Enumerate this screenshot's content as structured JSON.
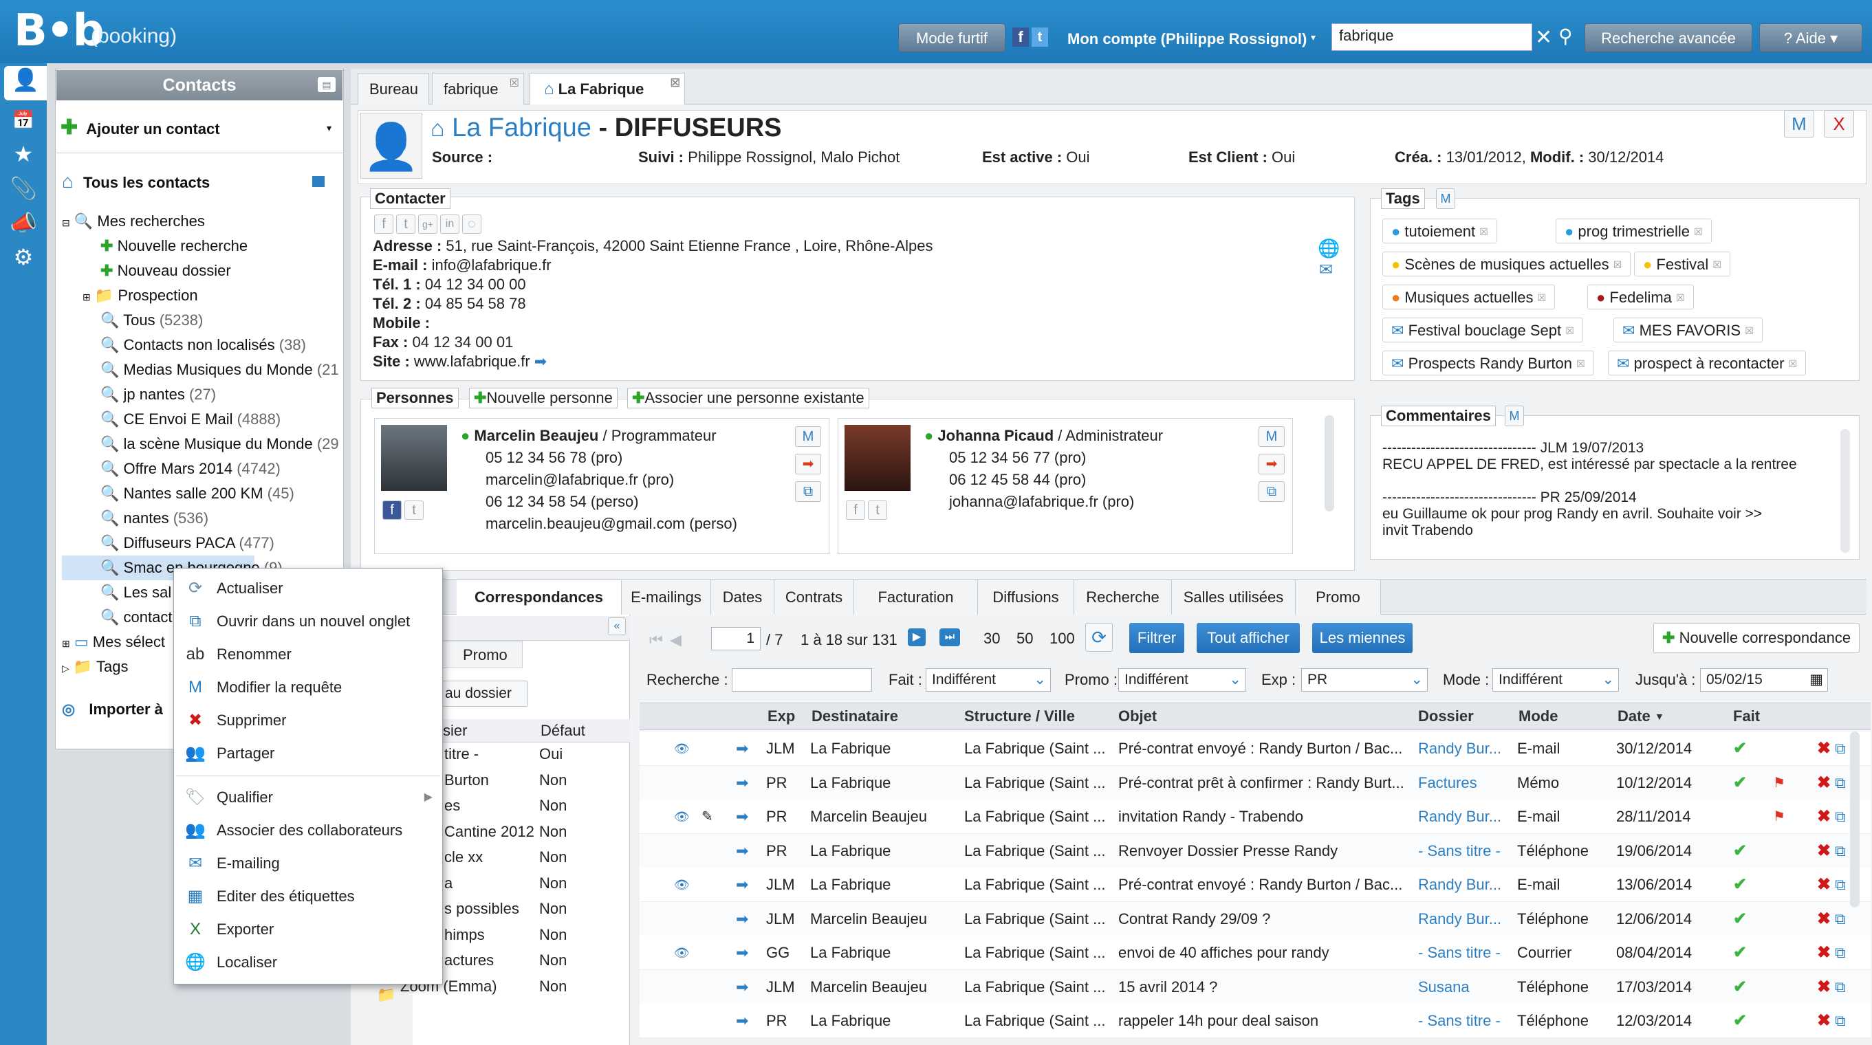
{
  "app": {
    "logo": "B•b",
    "logo_sub": "(booking)"
  },
  "header": {
    "mode_furtif": "Mode furtif",
    "account": "Mon compte (Philippe Rossignol)",
    "search_value": "fabrique",
    "advanced_search": "Recherche avancée",
    "help": "Aide"
  },
  "contacts_panel": {
    "title": "Contacts",
    "add_contact": "Ajouter un contact",
    "all_contacts": "Tous les contacts",
    "my_searches": "Mes recherches",
    "new_search": "Nouvelle recherche",
    "new_folder": "Nouveau dossier",
    "prospection": "Prospection",
    "searches": [
      {
        "label": "Tous",
        "count": "(5238)"
      },
      {
        "label": "Contacts non localisés",
        "count": "(38)"
      },
      {
        "label": "Medias Musiques du Monde",
        "count": "(21"
      },
      {
        "label": "jp nantes",
        "count": "(27)"
      },
      {
        "label": "CE Envoi E Mail",
        "count": "(4888)"
      },
      {
        "label": "la scène Musique du Monde",
        "count": "(29"
      },
      {
        "label": "Offre Mars 2014",
        "count": "(4742)"
      },
      {
        "label": "Nantes salle 200 KM",
        "count": "(45)"
      },
      {
        "label": "nantes",
        "count": "(536)"
      },
      {
        "label": "Diffuseurs PACA",
        "count": "(477)"
      },
      {
        "label": "Smac en bourgogne",
        "count": "(9)"
      },
      {
        "label": "Les sal",
        "count": ""
      },
      {
        "label": "contact",
        "count": ""
      }
    ],
    "my_selections": "Mes sélect",
    "tags": "Tags",
    "import": "Importer à"
  },
  "tabs": [
    {
      "label": "Bureau"
    },
    {
      "label": "fabrique"
    },
    {
      "label": "La Fabrique"
    }
  ],
  "record": {
    "name": "La Fabrique",
    "sep": "-",
    "category": "DIFFUSEURS",
    "source_label": "Source :",
    "suivi_label": "Suivi :",
    "suivi_value": "Philippe Rossignol, Malo Pichot",
    "active_label": "Est active :",
    "active_value": "Oui",
    "client_label": "Est Client :",
    "client_value": "Oui",
    "crea_label": "Créa. :",
    "crea_value": "13/01/2012,",
    "modif_label": "Modif. :",
    "modif_value": "30/12/2014",
    "m_btn": "M",
    "x_btn": "X"
  },
  "contacter": {
    "legend": "Contacter",
    "address_label": "Adresse :",
    "address": "51, rue Saint-François, 42000 Saint Etienne France , Loire, Rhône-Alpes",
    "email_label": "E-mail :",
    "email": "info@lafabrique.fr",
    "tel1_label": "Tél. 1 :",
    "tel1": "04 12 34 00 00",
    "tel2_label": "Tél. 2 :",
    "tel2": "04 85 54 58 78",
    "mobile_label": "Mobile :",
    "fax_label": "Fax :",
    "fax": "04 12 34 00 01",
    "site_label": "Site :",
    "site": "www.lafabrique.fr"
  },
  "tags_box": {
    "legend": "Tags",
    "items": [
      {
        "label": "tutoiement",
        "color": "#2a9be0",
        "kind": "dot"
      },
      {
        "label": "prog trimestrielle",
        "color": "#2a9be0",
        "kind": "dot"
      },
      {
        "label": "Scènes de musiques actuelles",
        "color": "#f2c200",
        "kind": "dot"
      },
      {
        "label": "Festival",
        "color": "#f2c200",
        "kind": "dot"
      },
      {
        "label": "Musiques actuelles",
        "color": "#f07a1a",
        "kind": "dot"
      },
      {
        "label": "Fedelima",
        "color": "#a01818",
        "kind": "dot"
      },
      {
        "label": "Festival bouclage Sept",
        "color": "#2a7fc2",
        "kind": "mail"
      },
      {
        "label": "MES FAVORIS",
        "color": "#2a7fc2",
        "kind": "mail"
      },
      {
        "label": "Prospects Randy Burton",
        "color": "#2a7fc2",
        "kind": "mail"
      },
      {
        "label": "prospect à recontacter",
        "color": "#2a7fc2",
        "kind": "mail"
      }
    ]
  },
  "comments": {
    "legend": "Commentaires",
    "lines": [
      "-------------------------------- JLM 19/07/2013",
      "RECU APPEL DE FRED, est intéressé par spectacle a la rentree",
      "",
      "-------------------------------- PR 25/09/2014",
      "eu Guillaume ok pour prog Randy en avril. Souhaite voir >>",
      "invit Trabendo"
    ]
  },
  "persons": {
    "legend": "Personnes",
    "new_person": "Nouvelle personne",
    "associate": "Associer une personne existante",
    "cards": [
      {
        "name": "Marcelin Beaujeu",
        "role": "/ Programmateur",
        "lines": [
          "05 12 34 56 78 (pro)",
          "marcelin@lafabrique.fr (pro)",
          "06 12 34 58 54 (perso)",
          "marcelin.beaujeu@gmail.com (perso)"
        ]
      },
      {
        "name": "Johanna Picaud",
        "role": "/ Administrateur",
        "lines": [
          "05 12 34 56 77 (pro)",
          "06 12 45 58 44 (pro)",
          "johanna@lafabrique.fr (pro)"
        ]
      }
    ]
  },
  "subtabs": [
    "Correspondances",
    "E-mailings",
    "Dates",
    "Contrats",
    "Facturation",
    "Diffusions",
    "Recherche",
    "Salles utilisées",
    "Promo"
  ],
  "mid_panel": {
    "tab": "Promo",
    "btn": "au dossier",
    "col1": "sier",
    "col2": "Défaut",
    "rows": [
      {
        "a": "titre -",
        "b": "Oui"
      },
      {
        "a": "Burton",
        "b": "Non"
      },
      {
        "a": "es",
        "b": "Non"
      },
      {
        "a": "Cantine 2012",
        "b": "Non"
      },
      {
        "a": "cle xx",
        "b": "Non"
      },
      {
        "a": "a",
        "b": "Non"
      },
      {
        "a": "s possibles",
        "b": "Non"
      },
      {
        "a": "himps",
        "b": "Non"
      },
      {
        "a": "actures",
        "b": "Non"
      },
      {
        "a": "Zoom (Emma)",
        "b": "Non"
      }
    ]
  },
  "context_menu": [
    {
      "label": "Actualiser",
      "icon": "refresh-icon",
      "glyph": "⟳"
    },
    {
      "label": "Ouvrir dans un nouvel onglet",
      "icon": "new-tab-icon",
      "glyph": "⧉"
    },
    {
      "label": "Renommer",
      "icon": "rename-icon",
      "glyph": "ab"
    },
    {
      "label": "Modifier la requête",
      "icon": "edit-query-icon",
      "glyph": "M"
    },
    {
      "label": "Supprimer",
      "icon": "delete-icon",
      "glyph": "✖"
    },
    {
      "label": "Partager",
      "icon": "share-icon",
      "glyph": "👥"
    },
    {
      "label": "Qualifier",
      "icon": "tag-icon",
      "glyph": "🏷"
    },
    {
      "label": "Associer des collaborateurs",
      "icon": "collaborators-icon",
      "glyph": "👥"
    },
    {
      "label": "E-mailing",
      "icon": "mail-icon",
      "glyph": "✉"
    },
    {
      "label": "Editer des étiquettes",
      "icon": "labels-icon",
      "glyph": "▦"
    },
    {
      "label": "Exporter",
      "icon": "excel-icon",
      "glyph": "X"
    },
    {
      "label": "Localiser",
      "icon": "globe-icon",
      "glyph": "🌐"
    }
  ],
  "correspondences": {
    "page_value": "1",
    "page_total": "/ 7",
    "range": "1 à 18 sur 131",
    "sizes": [
      "30",
      "50",
      "100"
    ],
    "filter": "Filtrer",
    "show_all": "Tout afficher",
    "mine": "Les miennes",
    "new_corr": "Nouvelle correspondance",
    "search_label": "Recherche :",
    "fait_label": "Fait :",
    "fait_value": "Indifférent",
    "promo_label": "Promo :",
    "promo_value": "Indifférent",
    "exp_label": "Exp :",
    "exp_value": "PR",
    "mode_label": "Mode :",
    "mode_value": "Indifférent",
    "until_label": "Jusqu'à :",
    "until_value": "05/02/15",
    "columns": [
      "Exp",
      "Destinataire",
      "Structure / Ville",
      "Objet",
      "Dossier",
      "Mode",
      "Date",
      "Fait"
    ],
    "rows": [
      {
        "eye": true,
        "note": false,
        "exp": "JLM",
        "dest": "La Fabrique",
        "struct": "La Fabrique (Saint ...",
        "obj": "Pré-contrat envoyé : Randy Burton / Bac...",
        "dossier": "Randy Bur...",
        "mode": "E-mail",
        "date": "30/12/2014",
        "fait": true,
        "flag": false
      },
      {
        "eye": false,
        "note": false,
        "exp": "PR",
        "dest": "La Fabrique",
        "struct": "La Fabrique (Saint ...",
        "obj": "Pré-contrat prêt à confirmer : Randy Burt...",
        "dossier": "Factures",
        "mode": "Mémo",
        "date": "10/12/2014",
        "fait": true,
        "flag": true
      },
      {
        "eye": true,
        "note": true,
        "exp": "PR",
        "dest": "Marcelin Beaujeu",
        "struct": "La Fabrique (Saint ...",
        "obj": "invitation Randy - Trabendo",
        "dossier": "Randy Bur...",
        "mode": "E-mail",
        "date": "28/11/2014",
        "fait": false,
        "flag": true
      },
      {
        "eye": false,
        "note": false,
        "exp": "PR",
        "dest": "La Fabrique",
        "struct": "La Fabrique (Saint ...",
        "obj": "Renvoyer Dossier Presse Randy",
        "dossier": "- Sans titre -",
        "mode": "Téléphone",
        "date": "19/06/2014",
        "fait": true,
        "flag": false
      },
      {
        "eye": true,
        "note": false,
        "exp": "JLM",
        "dest": "La Fabrique",
        "struct": "La Fabrique (Saint ...",
        "obj": "Pré-contrat envoyé : Randy Burton / Bac...",
        "dossier": "Randy Bur...",
        "mode": "E-mail",
        "date": "13/06/2014",
        "fait": true,
        "flag": false
      },
      {
        "eye": false,
        "note": false,
        "exp": "JLM",
        "dest": "Marcelin Beaujeu",
        "struct": "La Fabrique (Saint ...",
        "obj": "Contrat Randy 29/09 ?",
        "dossier": "Randy Bur...",
        "mode": "Téléphone",
        "date": "12/06/2014",
        "fait": true,
        "flag": false
      },
      {
        "eye": true,
        "note": false,
        "exp": "GG",
        "dest": "La Fabrique",
        "struct": "La Fabrique (Saint ...",
        "obj": "envoi de 40 affiches pour randy",
        "dossier": "- Sans titre -",
        "mode": "Courrier",
        "date": "08/04/2014",
        "fait": true,
        "flag": false
      },
      {
        "eye": false,
        "note": false,
        "exp": "JLM",
        "dest": "Marcelin Beaujeu",
        "struct": "La Fabrique (Saint ...",
        "obj": "15 avril 2014 ?",
        "dossier": "Susana",
        "mode": "Téléphone",
        "date": "17/03/2014",
        "fait": true,
        "flag": false
      },
      {
        "eye": false,
        "note": false,
        "exp": "PR",
        "dest": "La Fabrique",
        "struct": "La Fabrique (Saint ...",
        "obj": "rappeler 14h pour deal saison",
        "dossier": "- Sans titre -",
        "mode": "Téléphone",
        "date": "12/03/2014",
        "fait": true,
        "flag": false
      }
    ]
  }
}
